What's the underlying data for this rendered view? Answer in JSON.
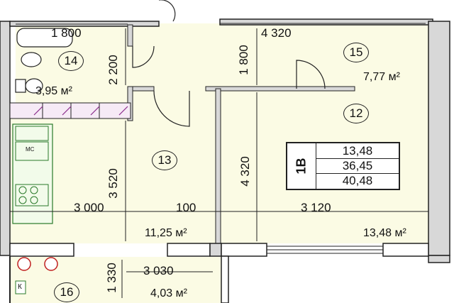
{
  "rooms": [
    {
      "id": "14",
      "area": "3,95 м²"
    },
    {
      "id": "15",
      "area": "7,77 м²"
    },
    {
      "id": "12",
      "area": "13,48 м²"
    },
    {
      "id": "13",
      "area": "11,25 м²"
    },
    {
      "id": "16",
      "area": "4,03 м²"
    }
  ],
  "dimensions": {
    "top_left": "1 800",
    "top_right": "4 320",
    "bath_height": "2 200",
    "hall_height": "1 800",
    "room13_height": "3 520",
    "room12_height": "4 320",
    "room13_width": "3 000",
    "gap": "100",
    "room12_width": "3 120",
    "balcony_height": "1 330",
    "balcony_width": "3 030"
  },
  "info": {
    "type": "1В",
    "values": [
      "13,48",
      "36,45",
      "40,48"
    ]
  },
  "appliance_labels": {
    "microwave": "МС",
    "balcony_k": "К"
  }
}
